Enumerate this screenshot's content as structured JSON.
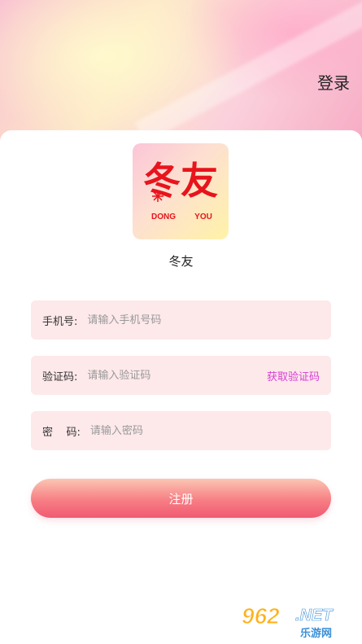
{
  "header": {
    "login_label": "登录"
  },
  "logo": {
    "main_text": "冬友",
    "sub_left": "DONG",
    "sub_right": "YOU"
  },
  "app": {
    "name": "冬友"
  },
  "form": {
    "phone": {
      "label": "手机号:",
      "placeholder": "请输入手机号码",
      "value": ""
    },
    "code": {
      "label": "验证码:",
      "placeholder": "请输入验证码",
      "value": "",
      "get_code_label": "获取验证码"
    },
    "password": {
      "label": "密    码:",
      "placeholder": "请输入密码",
      "value": ""
    },
    "register_label": "注册"
  },
  "watermark": {
    "number": "962",
    "suffix": ".NET",
    "subtitle": "乐游网"
  },
  "colors": {
    "field_bg": "#fde8ea",
    "accent_link": "#d63fd4",
    "button_gradient_end": "#f05a72"
  }
}
